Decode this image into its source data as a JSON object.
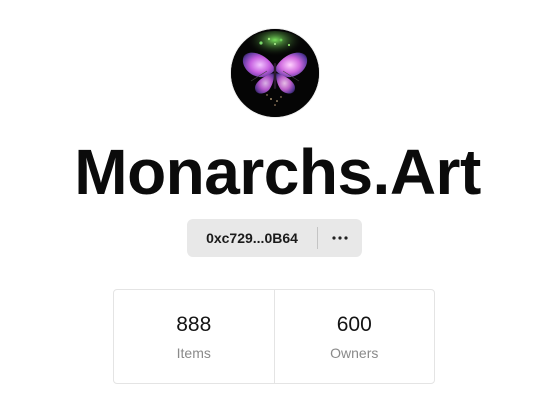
{
  "collection": {
    "name": "Monarchs.Art",
    "address_short": "0xc729...0B64",
    "more_label": "..."
  },
  "stats": [
    {
      "value": "888",
      "label": "Items"
    },
    {
      "value": "600",
      "label": "Owners"
    }
  ],
  "icons": {
    "avatar": "butterfly-logo",
    "more": "more-horizontal-icon"
  }
}
